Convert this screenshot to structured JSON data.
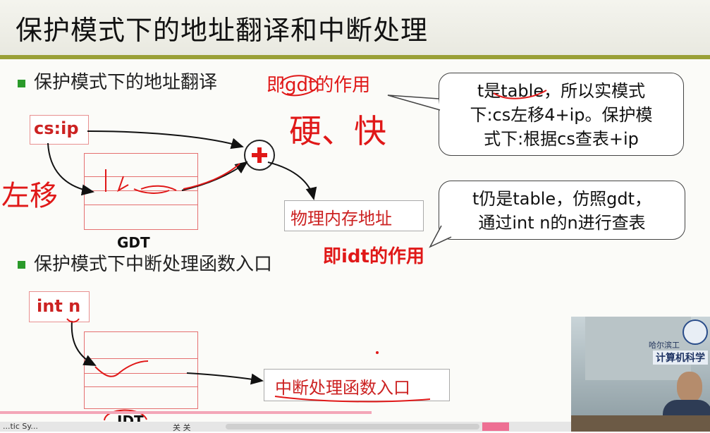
{
  "title": "保护模式下的地址翻译和中断处理",
  "bullets": [
    {
      "text": "保护模式下的地址翻译"
    },
    {
      "text": "保护模式下中断处理函数入口"
    }
  ],
  "section1": {
    "csip_label": "cs:ip",
    "gdt_label": "GDT",
    "phys_label": "物理内存地址",
    "plus_icon": "plus-circle-icon"
  },
  "section2": {
    "intn_label": "int n",
    "idt_label": "IDT",
    "entry_label": "中断处理函数入口"
  },
  "annotations": {
    "gdt_role": "即gdt的作用",
    "idt_role": "即idt的作用",
    "hand_fast": "硬、快",
    "hand_shift": "左移"
  },
  "bubbles": {
    "top": [
      "t是table，所以实模式",
      "下:cs左移4+ip。保护模",
      "式下:根据cs查表+ip"
    ],
    "bottom": [
      "t仍是table，仿照gdt，",
      "通过int n的n进行查表"
    ]
  },
  "webcam": {
    "banner_text": "计算机科学",
    "seal_text": "哈尔滨工"
  },
  "bottom_bar": {
    "left_text": "...tic Sy...",
    "nav": "关 关"
  },
  "colors": {
    "accent_green": "#2a9a2a",
    "rule": "#9aa036",
    "red": "#cc2222",
    "hand_red": "#e01818"
  }
}
